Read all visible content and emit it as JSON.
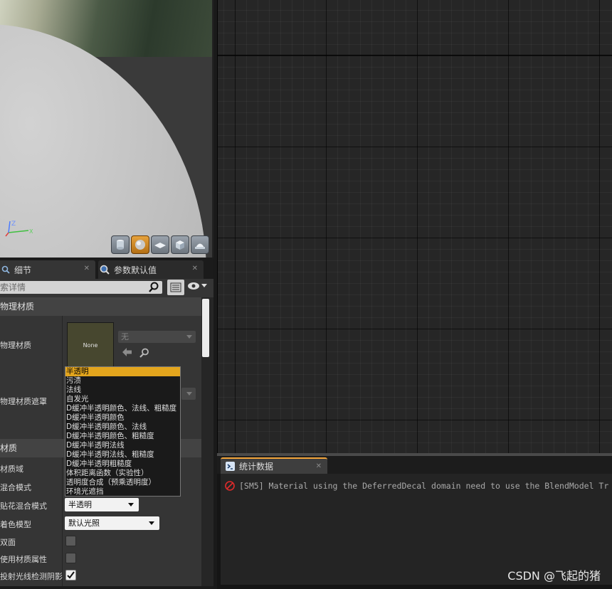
{
  "viewport": {
    "axis_labels": {
      "z": "Z",
      "x": "X"
    },
    "preview_shapes": [
      "cylinder-icon",
      "sphere-icon",
      "plane-icon",
      "cube-icon",
      "custom-mesh-icon"
    ]
  },
  "details": {
    "tab_details": "细节",
    "tab_defaults": "参数默认值",
    "search_placeholder": "索详情",
    "category_physical": "物理材质",
    "label_phys_mat": "物理材质",
    "thumbnail_text": "None",
    "phys_mat_combo": "无",
    "label_phys_mat_mask": "物理材质遮罩",
    "category_material": "材质",
    "label_domain": "材质域",
    "label_blend_mode": "混合模式",
    "label_decal_blend": "贴花混合模式",
    "decal_blend_value": "半透明",
    "label_shading": "着色模型",
    "shading_value": "默认光照",
    "label_two_sided": "双面",
    "label_material_attributes": "使用材质属性",
    "label_cast_ray_shadows": "投射光线检测阴影",
    "two_sided_checked": false,
    "material_attributes_checked": false,
    "cast_ray_shadows_checked": true
  },
  "dropdown": {
    "selected_index": 0,
    "options": [
      "半透明",
      "污渍",
      "法线",
      "自发光",
      "D缓冲半透明颜色、法线、粗糙度",
      "D缓冲半透明颜色",
      "D缓冲半透明颜色、法线",
      "D缓冲半透明颜色、粗糙度",
      "D缓冲半透明法线",
      "D缓冲半透明法线、粗糙度",
      "D缓冲半透明粗糙度",
      "体积距离函数（实验性）",
      "透明度合成（预乘透明度）",
      "环境光遮挡"
    ]
  },
  "stats": {
    "tab_label": "统计数据",
    "message": "[SM5] Material using the DeferredDecal domain need to use the BlendModel Tr",
    "message_icon": "error-icon"
  },
  "watermark": "CSDN @飞起的猪"
}
